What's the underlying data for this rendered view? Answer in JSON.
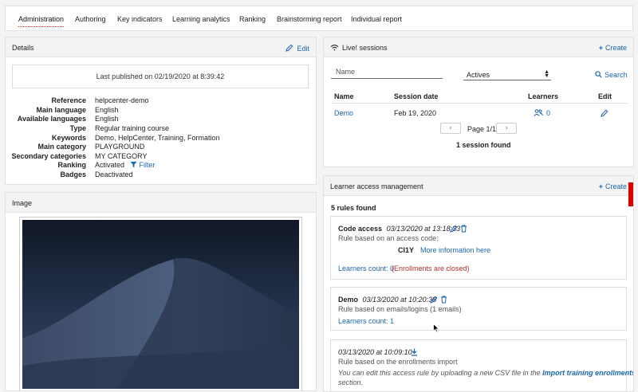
{
  "tabs": [
    {
      "label": "Administration",
      "active": true
    },
    {
      "label": "Authoring"
    },
    {
      "label": "Key indicators"
    },
    {
      "label": "Learning analytics"
    },
    {
      "label": "Ranking"
    },
    {
      "label": "Brainstorming report"
    },
    {
      "label": "Individual report"
    }
  ],
  "details": {
    "title": "Details",
    "edit_label": "Edit",
    "published": "Last published on 02/19/2020 at 8:39:42",
    "rows": [
      {
        "label": "Reference",
        "value": "helpcenter-demo"
      },
      {
        "label": "Main language",
        "value": "English"
      },
      {
        "label": "Available languages",
        "value": "English"
      },
      {
        "label": "Type",
        "value": "Regular training course"
      },
      {
        "label": "Keywords",
        "value": "Demo, HelpCenter, Training, Formation"
      },
      {
        "label": "Main category",
        "value": "PLAYGROUND"
      },
      {
        "label": "Secondary categories",
        "value": "MY CATEGORY"
      },
      {
        "label": "Ranking",
        "value": "Activated",
        "filter_label": "Filter"
      },
      {
        "label": "Badges",
        "value": "Deactivated"
      }
    ]
  },
  "image_panel": {
    "title": "Image"
  },
  "sessions": {
    "title": "Live! sessions",
    "create_label": "Create",
    "name_placeholder": "Name",
    "status_select": "Actives",
    "search_label": "Search",
    "columns": [
      "Name",
      "Session date",
      "Learners",
      "Edit"
    ],
    "rows": [
      {
        "name": "Demo",
        "date": "Feb 19, 2020",
        "learners": "0"
      }
    ],
    "page_label": "Page 1/1",
    "found_label": "1 session found"
  },
  "access": {
    "title": "Learner access management",
    "create_label": "Create",
    "count_label": "5 rules found",
    "rules": [
      {
        "name": "Code access",
        "date": "03/13/2020 at 13:18:33",
        "desc": "Rule based on an access code:",
        "code": "CI1Y",
        "more_info": "More information here",
        "learners": "Learners count: 0",
        "status": "(Enrollments are closed)"
      },
      {
        "name": "Demo",
        "date": "03/13/2020 at 10:20:38",
        "desc": "Rule based on emails/logins (1 emails)",
        "learners": "Learners count: 1"
      },
      {
        "date": "03/13/2020 at 10:09:10",
        "desc": "Rule based on the enrollments import",
        "note_pre": "You can edit this access rule by uploading a new CSV file in the",
        "note_link": "Import training enrollments",
        "note_post": "section."
      }
    ]
  },
  "colors": {
    "link": "#1a66b0",
    "danger": "#b03030",
    "accent_red": "#dd0000"
  }
}
